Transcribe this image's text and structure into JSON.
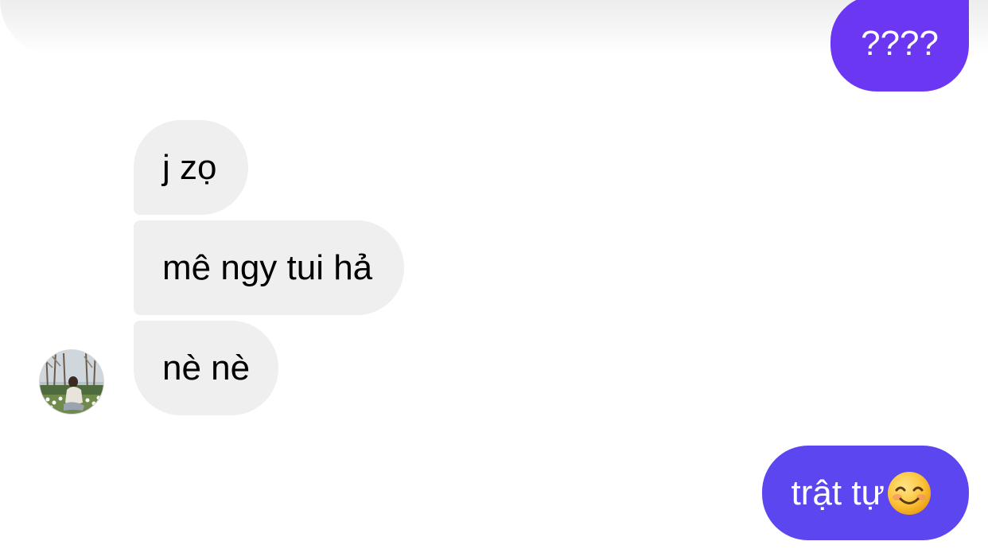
{
  "colors": {
    "outgoing_top": "#6c37f2",
    "outgoing_bottom": "#5b46f0",
    "incoming": "#efefef"
  },
  "messages": {
    "outgoing_1": "????",
    "incoming_1": "j zọ",
    "incoming_2": "mê ngy tui hả",
    "incoming_3": "nè nè",
    "outgoing_2": "trật tự"
  },
  "icons": {
    "emoji": "smiling-face-with-smiling-eyes-emoji",
    "avatar": "contact-avatar"
  }
}
